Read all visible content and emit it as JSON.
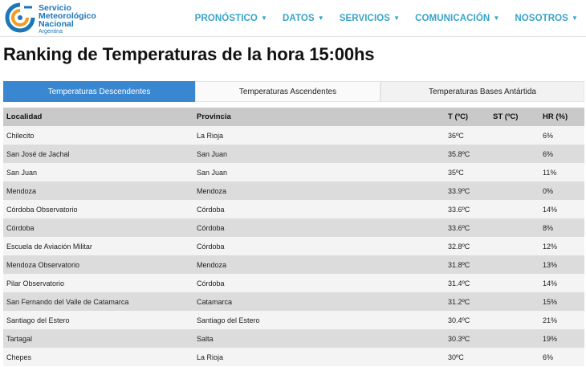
{
  "header": {
    "logo": {
      "line1": "Servicio",
      "line2": "Meteorológico",
      "line3": "Nacional",
      "country": "Argentina",
      "colors": {
        "blue": "#1c76b9",
        "orange": "#f39a1f"
      }
    },
    "nav": [
      {
        "label": "PRONÓSTICO"
      },
      {
        "label": "DATOS"
      },
      {
        "label": "SERVICIOS"
      },
      {
        "label": "COMUNICACIÓN"
      },
      {
        "label": "NOSOTROS"
      }
    ],
    "accent_color": "#37a3c9"
  },
  "page_title": "Ranking de Temperaturas de la hora 15:00hs",
  "tabs": [
    {
      "label": "Temperaturas Descendentes",
      "active": true
    },
    {
      "label": "Temperaturas Ascendentes",
      "active": false
    },
    {
      "label": "Temperaturas Bases Antártida",
      "active": false
    }
  ],
  "table": {
    "headers": [
      "Localidad",
      "Provincia",
      "T (ºC)",
      "ST (ºC)",
      "HR (%)"
    ],
    "rows": [
      [
        "Chilecito",
        "La Rioja",
        "36ºC",
        "",
        "6%"
      ],
      [
        "San José de Jachal",
        "San Juan",
        "35.8ºC",
        "",
        "6%"
      ],
      [
        "San Juan",
        "San Juan",
        "35ºC",
        "",
        "11%"
      ],
      [
        "Mendoza",
        "Mendoza",
        "33.9ºC",
        "",
        "0%"
      ],
      [
        "Córdoba Observatorio",
        "Córdoba",
        "33.6ºC",
        "",
        "14%"
      ],
      [
        "Córdoba",
        "Córdoba",
        "33.6ºC",
        "",
        "8%"
      ],
      [
        "Escuela de Aviación Militar",
        "Córdoba",
        "32.8ºC",
        "",
        "12%"
      ],
      [
        "Mendoza Observatorio",
        "Mendoza",
        "31.8ºC",
        "",
        "13%"
      ],
      [
        "Pilar Observatorio",
        "Córdoba",
        "31.4ºC",
        "",
        "14%"
      ],
      [
        "San Fernando del Valle de Catamarca",
        "Catamarca",
        "31.2ºC",
        "",
        "15%"
      ],
      [
        "Santiago del Estero",
        "Santiago del Estero",
        "30.4ºC",
        "",
        "21%"
      ],
      [
        "Tartagal",
        "Salta",
        "30.3ºC",
        "",
        "19%"
      ],
      [
        "Chepes",
        "La Rioja",
        "30ºC",
        "",
        "6%"
      ]
    ]
  }
}
